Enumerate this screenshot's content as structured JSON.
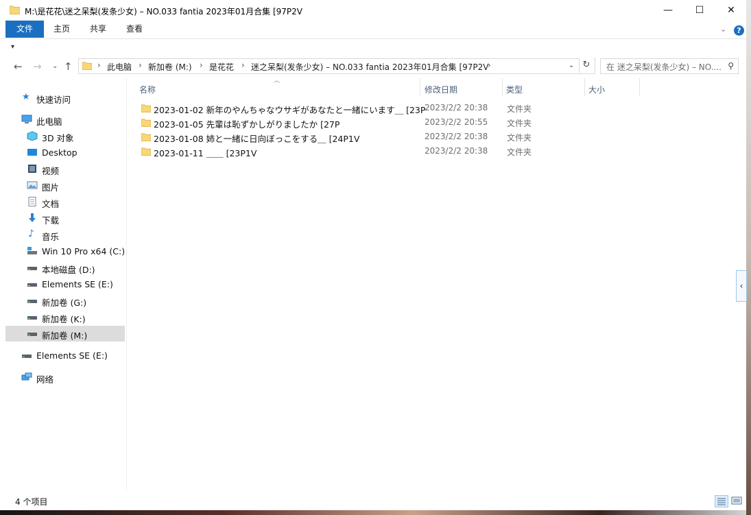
{
  "window": {
    "title": "M:\\是花花\\迷之呆梨(发条少女) – NO.033 fantia 2023年01月合集 [97P2V",
    "controls": {
      "minimize": "—",
      "maximize": "☐",
      "close": "✕"
    }
  },
  "ribbon": {
    "tabs": [
      "文件",
      "主页",
      "共享",
      "查看"
    ],
    "expand": "⌄",
    "help": "?"
  },
  "address": {
    "crumbs": [
      "此电脑",
      "新加卷 (M:)",
      "是花花",
      "迷之呆梨(发条少女) – NO.033 fantia 2023年01月合集 [97P2V"
    ],
    "search_placeholder": "在 迷之呆梨(发条少女) – NO...."
  },
  "nav": {
    "quick_access": "快速访问",
    "this_pc": "此电脑",
    "items": [
      {
        "label": "3D 对象",
        "icon": "3d-objects-icon"
      },
      {
        "label": "Desktop",
        "icon": "desktop-icon"
      },
      {
        "label": "视频",
        "icon": "video-icon"
      },
      {
        "label": "图片",
        "icon": "pictures-icon"
      },
      {
        "label": "文档",
        "icon": "documents-icon"
      },
      {
        "label": "下载",
        "icon": "download-icon"
      },
      {
        "label": "音乐",
        "icon": "music-icon"
      },
      {
        "label": "Win 10 Pro x64 (C:)",
        "icon": "system-drive-icon"
      },
      {
        "label": "本地磁盘 (D:)",
        "icon": "drive-icon"
      },
      {
        "label": "Elements SE (E:)",
        "icon": "drive-icon"
      },
      {
        "label": "新加卷 (G:)",
        "icon": "drive-icon"
      },
      {
        "label": "新加卷 (K:)",
        "icon": "drive-icon"
      },
      {
        "label": "新加卷 (M:)",
        "icon": "drive-icon",
        "selected": true
      }
    ],
    "external": "Elements SE (E:)",
    "network": "网络"
  },
  "columns": {
    "name": "名称",
    "modified": "修改日期",
    "type": "类型",
    "size": "大小"
  },
  "files": [
    {
      "name": "2023-01-02 新年のやんちゃなウサギがあなたと一緒にいます＿ [23P",
      "modified": "2023/2/2 20:38",
      "type": "文件夹"
    },
    {
      "name": "2023-01-05 先輩は恥ずかしがりましたか [27P",
      "modified": "2023/2/2 20:55",
      "type": "文件夹"
    },
    {
      "name": "2023-01-08 姉と一緒に日向ぼっこをする＿ [24P1V",
      "modified": "2023/2/2 20:38",
      "type": "文件夹"
    },
    {
      "name": "2023-01-11 ＿＿ [23P1V",
      "modified": "2023/2/2 20:38",
      "type": "文件夹"
    }
  ],
  "status": {
    "count": "4 个项目"
  }
}
